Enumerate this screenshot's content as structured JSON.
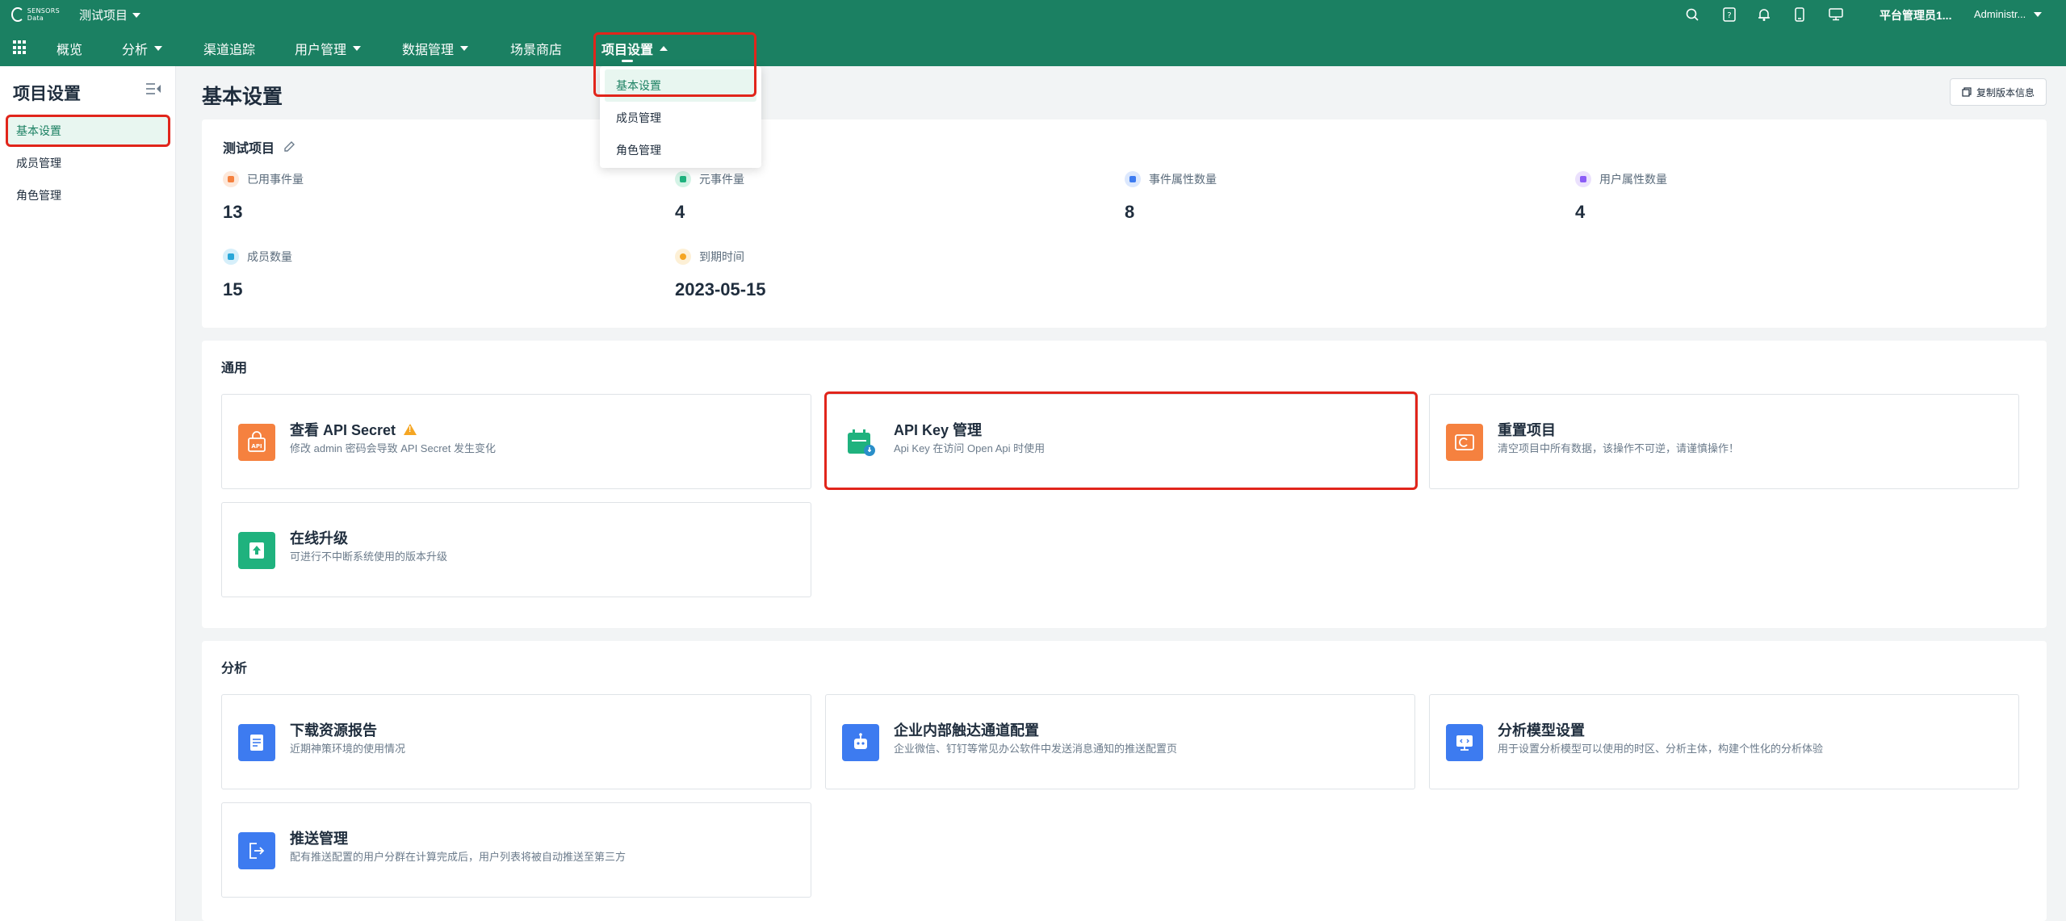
{
  "header": {
    "logo_text_line1": "SENSORS",
    "logo_text_line2": "Data",
    "project_name": "测试项目",
    "user_name": "平台管理员1...",
    "user_role": "Administr...",
    "icons": [
      "search-icon",
      "help-icon",
      "bell-icon",
      "mobile-icon",
      "monitor-icon"
    ]
  },
  "nav": {
    "items": [
      {
        "label": "概览",
        "has_caret": false
      },
      {
        "label": "分析",
        "has_caret": true
      },
      {
        "label": "渠道追踪",
        "has_caret": false
      },
      {
        "label": "用户管理",
        "has_caret": true
      },
      {
        "label": "数据管理",
        "has_caret": true
      },
      {
        "label": "场景商店",
        "has_caret": false
      },
      {
        "label": "项目设置",
        "has_caret": true,
        "active": true
      }
    ]
  },
  "dropdown": {
    "items": [
      "基本设置",
      "成员管理",
      "角色管理"
    ],
    "selected": "基本设置"
  },
  "sidebar": {
    "title": "项目设置",
    "items": [
      "基本设置",
      "成员管理",
      "角色管理"
    ],
    "active": "基本设置"
  },
  "main": {
    "title": "基本设置",
    "copy_button": "复制版本信息",
    "project": {
      "name": "测试项目",
      "stats": [
        {
          "label": "已用事件量",
          "value": "13",
          "color": "#f5813f"
        },
        {
          "label": "元事件量",
          "value": "4",
          "color": "#1fb27e"
        },
        {
          "label": "事件属性数量",
          "value": "8",
          "color": "#3d7bf0"
        },
        {
          "label": "用户属性数量",
          "value": "4",
          "color": "#8b5cf6"
        },
        {
          "label": "成员数量",
          "value": "15",
          "color": "#2aa7d8"
        },
        {
          "label": "到期时间",
          "value": "2023-05-15",
          "color": "#f5a623"
        }
      ]
    },
    "general": {
      "title": "通用",
      "tiles": [
        {
          "title": "查看 API Secret",
          "desc": "修改 admin 密码会导致 API Secret 发生变化",
          "color": "#f5813f",
          "icon": "api-icon",
          "warning": true
        },
        {
          "title": "API Key 管理",
          "desc": "Api Key 在访问 Open Api 时使用",
          "color": "#1fb27e",
          "icon": "key-calendar-icon",
          "warning": false
        },
        {
          "title": "重置项目",
          "desc": "清空项目中所有数据，该操作不可逆，请谨慎操作！",
          "color": "#f5813f",
          "icon": "reset-icon",
          "warning": false
        },
        {
          "title": "在线升级",
          "desc": "可进行不中断系统使用的版本升级",
          "color": "#1fb27e",
          "icon": "upload-icon",
          "warning": false
        }
      ]
    },
    "analysis": {
      "title": "分析",
      "tiles": [
        {
          "title": "下载资源报告",
          "desc": "近期神策环境的使用情况",
          "color": "#3d7bf0",
          "icon": "report-icon"
        },
        {
          "title": "企业内部触达通道配置",
          "desc": "企业微信、钉钉等常见办公软件中发送消息通知的推送配置页",
          "color": "#3d7bf0",
          "icon": "robot-icon"
        },
        {
          "title": "分析模型设置",
          "desc": "用于设置分析模型可以使用的时区、分析主体，构建个性化的分析体验",
          "color": "#3d7bf0",
          "icon": "model-icon"
        },
        {
          "title": "推送管理",
          "desc": "配有推送配置的用户分群在计算完成后，用户列表将被自动推送至第三方",
          "color": "#3d7bf0",
          "icon": "push-icon"
        }
      ]
    }
  }
}
